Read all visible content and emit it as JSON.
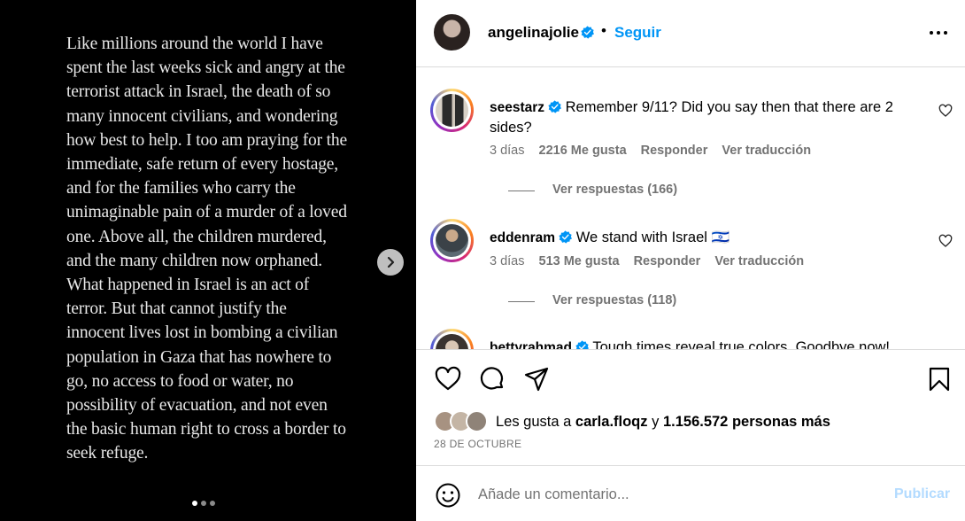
{
  "post_image": {
    "quote": "Like millions around the world I have spent the last weeks sick and angry at the terrorist attack in Israel, the death of so many innocent civilians, and wondering how best to help. I too am praying for the immediate, safe return of every hostage, and for the families who carry the unimaginable pain of a murder of a loved one. Above all, the children murdered, and the many children now orphaned. What happened in Israel is an act of terror. But that cannot justify the innocent lives lost in bombing a civilian population in Gaza that has nowhere to go, no access to food or water, no possibility of evacuation, and not even the basic human right to cross a border to seek refuge.",
    "next_icon": "chevron-right-icon",
    "carousel_dots": 3,
    "active_dot": 0
  },
  "header": {
    "username": "angelinajolie",
    "verified_icon": "verified-badge-icon",
    "separator": "•",
    "follow_label": "Seguir",
    "more_icon": "more-options-icon"
  },
  "comments": [
    {
      "username": "seestarz",
      "text": "Remember 9/11? Did you say then that there are 2 sides?",
      "time": "3 días",
      "likes": "2216 Me gusta",
      "reply_label": "Responder",
      "translate_label": "Ver traducción",
      "replies_label": "Ver respuestas (166)"
    },
    {
      "username": "eddenram",
      "text": "We stand with Israel 🇮🇱",
      "time": "3 días",
      "likes": "513 Me gusta",
      "reply_label": "Responder",
      "translate_label": "Ver traducción",
      "replies_label": "Ver respuestas (118)"
    },
    {
      "username": "bettyrahmad",
      "text": "Tough times reveal true colors. Goodbye now!"
    }
  ],
  "actions": {
    "like_icon": "heart-icon",
    "comment_icon": "comment-icon",
    "share_icon": "paper-plane-icon",
    "save_icon": "bookmark-icon"
  },
  "likes": {
    "prefix": "Les gusta a",
    "user": "carla.floqz",
    "conj": "y",
    "count": "1.156.572 personas más"
  },
  "date": "28 DE OCTUBRE",
  "add_comment": {
    "emoji_icon": "smiley-icon",
    "placeholder": "Añade un comentario...",
    "publish_label": "Publicar"
  },
  "colors": {
    "accent": "#0095f6",
    "publish_disabled": "#b3dbff",
    "secondary_text": "#737373",
    "verified": "#0095f6"
  }
}
